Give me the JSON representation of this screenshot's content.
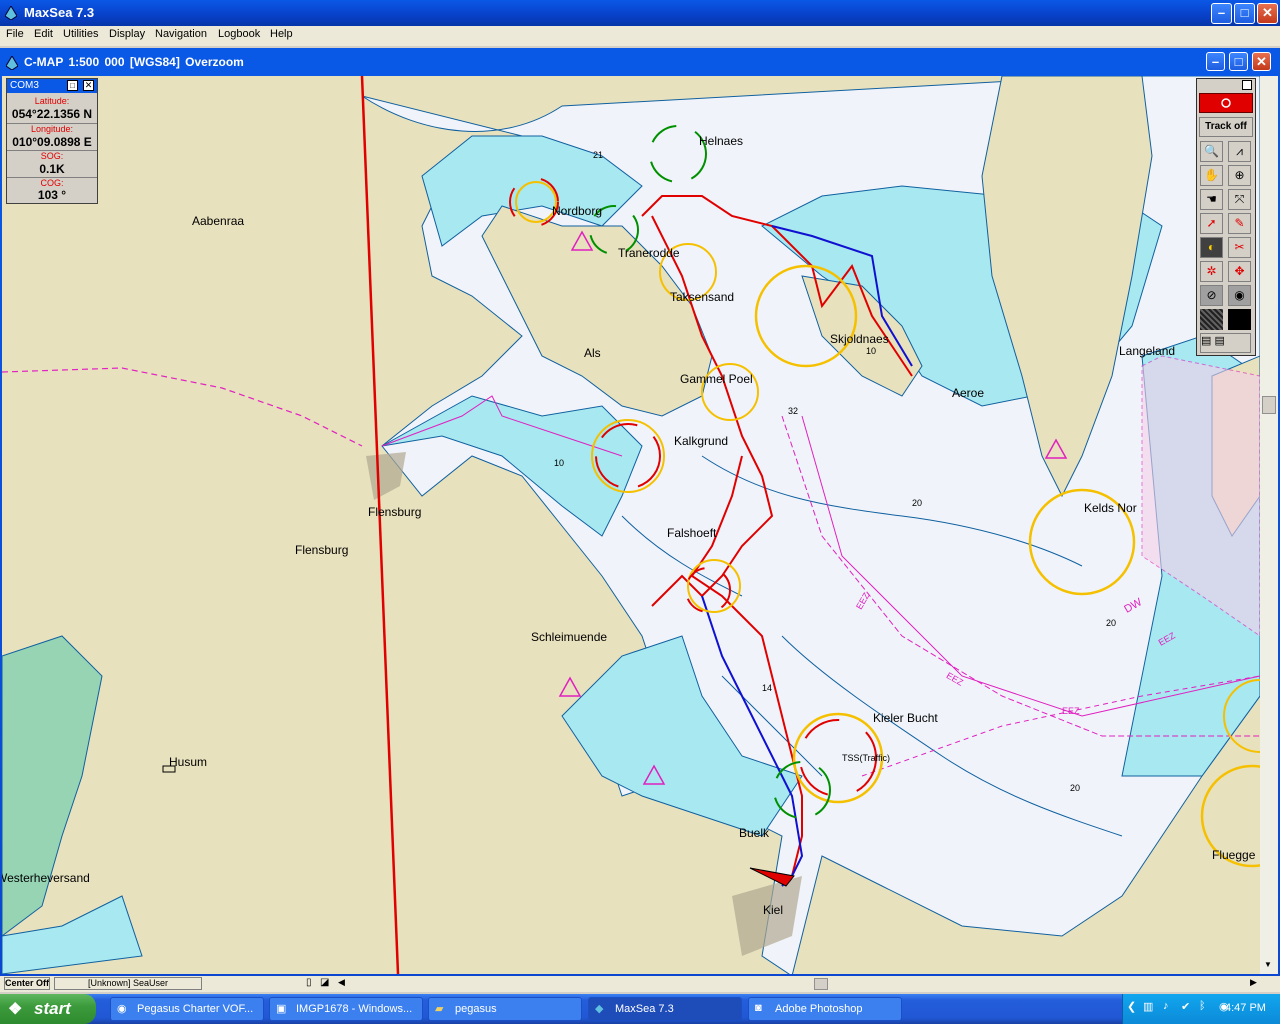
{
  "app": {
    "title": "MaxSea 7.3"
  },
  "menu": [
    "File",
    "Edit",
    "Utilities",
    "Display",
    "Navigation",
    "Logbook",
    "Help"
  ],
  "chart_window": {
    "title": "C-MAP  1:500 000 [WGS84]    Overzoom"
  },
  "databox": {
    "port": "COM3",
    "lat_label": "Latitude:",
    "lat_value": "054°22.1356 N",
    "lon_label": "Longitude:",
    "lon_value": "010°09.0898 E",
    "sog_label": "SOG:",
    "sog_value": "0.1K",
    "cog_label": "COG:",
    "cog_value": "103 °"
  },
  "toolbar": {
    "track_label": "Track off"
  },
  "map_labels": {
    "aabenraa": "Aabenraa",
    "helnaes": "Helnaes",
    "nordborg": "Nordborg",
    "tranerodde": "Tranerodde",
    "taksensand": "Taksensand",
    "als": "Als",
    "skjoldnaes": "Skjoldnaes",
    "langeland": "Langeland",
    "gammel_poel": "Gammel Poel",
    "aeroe": "Aeroe",
    "kalkgrund": "Kalkgrund",
    "flensburg1": "Flensburg",
    "flensburg2": "Flensburg",
    "falshoeft": "Falshoeft",
    "keldsnor": "Kelds Nor",
    "schleimuende": "Schleimuende",
    "kieler_bucht": "Kieler Bucht",
    "traffic": "TSS(Traffic)",
    "husum": "Husum",
    "buelk": "Buelk",
    "kiel": "Kiel",
    "westerheversand": "Westerheversand",
    "fluegge": "Fluegge",
    "eez1": "EEZ",
    "eez2": "EEZ",
    "eez3": "EEZ",
    "eez4": "EEZ",
    "dw": "DW",
    "d21": "21",
    "d32": "32",
    "d14": "14",
    "d20": "20",
    "d10a": "10",
    "d20b": "20",
    "d10c": "10",
    "d20d": "20"
  },
  "statusbar": {
    "center": "Center Off",
    "user": "[Unknown] SeaUser"
  },
  "taskbar": {
    "start": "start",
    "tasks": [
      "Pegasus Charter VOF...",
      "IMGP1678 - Windows...",
      "pegasus",
      "MaxSea 7.3",
      "Adobe Photoshop"
    ],
    "clock": "4:47 PM"
  },
  "colors": {
    "land": "#e8e1bd",
    "shallow": "#a8e8f0",
    "water": "#f0f4fa",
    "track_red": "#e00000",
    "track_blue": "#1010d0",
    "eez": "#e020c0"
  }
}
